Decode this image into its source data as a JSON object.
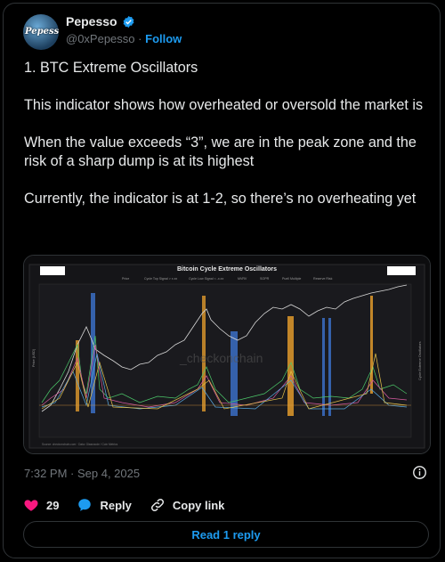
{
  "author": {
    "display_name": "Pepesso",
    "handle": "@0xPepesso",
    "separator": "·",
    "follow_label": "Follow",
    "avatar_text": "Pepesso"
  },
  "tweet": {
    "text": "1. BTC Extreme Oscillators\n\nThis indicator shows how overheated or oversold the market is\n\nWhen the value exceeds “3”, we are in the peak zone and the risk of a sharp dump is at its highest\n\nCurrently, the indicator is at 1-2, so there’s no overheating yet",
    "timestamp": "7:32 PM · Sep 4, 2025"
  },
  "actions": {
    "like_count": "29",
    "reply_label": "Reply",
    "copy_label": "Copy link",
    "read_reply_label": "Read 1 reply"
  },
  "colors": {
    "accent": "#1d9bf0",
    "like": "#f91880",
    "muted": "#71767b"
  },
  "chart_data": {
    "type": "line",
    "title": "Bitcoin Cycle Extreme Oscillators",
    "legend": [
      "Price",
      "Cycle Top Signal > x.xx",
      "Cycle Low Signal < -x.xx",
      "MVRV",
      "SOPR",
      "Puell Multiple",
      "Reserve Risk"
    ],
    "watermark": "_checkonchain",
    "ylabel_left": "Price (USD)",
    "ylabel_right": "Cycle Extreme Oscillators",
    "footer": "Source: checkonchain.com · Data: Glassnode / Coin Metrics"
  }
}
